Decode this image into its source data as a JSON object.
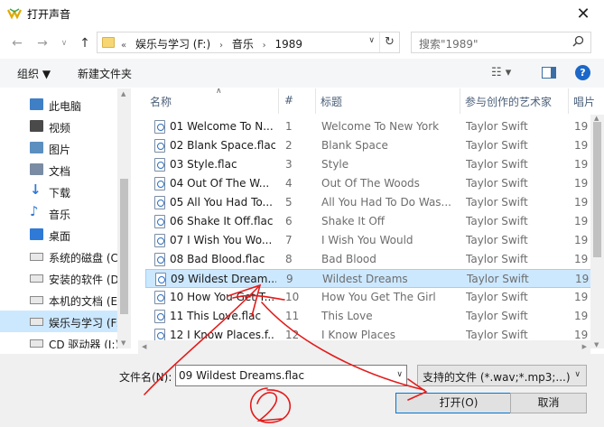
{
  "window": {
    "title": "打开声音",
    "close_glyph": "✕"
  },
  "address": {
    "prefix": "«",
    "crumbs": [
      "娱乐与学习 (F:)",
      "音乐",
      "1989"
    ],
    "separator": "›",
    "search_placeholder": "搜索\"1989\""
  },
  "toolbar": {
    "organize": "组织 ▼",
    "new_folder": "新建文件夹",
    "view_glyph": "☷ ▾",
    "help": "?"
  },
  "sidebar": {
    "items": [
      {
        "label": "此电脑",
        "icon": "computer-icon"
      },
      {
        "label": "视频",
        "icon": "video-icon"
      },
      {
        "label": "图片",
        "icon": "picture-icon"
      },
      {
        "label": "文档",
        "icon": "document-icon"
      },
      {
        "label": "下载",
        "icon": "download-icon"
      },
      {
        "label": "音乐",
        "icon": "music-icon"
      },
      {
        "label": "桌面",
        "icon": "desktop-icon"
      },
      {
        "label": "系统的磁盘 (C:)",
        "icon": "drive-icon"
      },
      {
        "label": "安装的软件 (D:)",
        "icon": "drive-icon"
      },
      {
        "label": "本机的文档 (E:)",
        "icon": "drive-icon"
      },
      {
        "label": "娱乐与学习 (F:)",
        "icon": "drive-icon"
      },
      {
        "label": "CD 驱动器 (I:)",
        "icon": "cd-drive-icon"
      }
    ],
    "selected_index": 10
  },
  "columns": {
    "name": "名称",
    "num": "#",
    "title": "标题",
    "artist": "参与创作的艺术家",
    "more": "唱片"
  },
  "files": [
    {
      "name": "01 Welcome To N...",
      "num": "1",
      "title": "Welcome To New York",
      "artist": "Taylor Swift",
      "more": "19"
    },
    {
      "name": "02 Blank Space.flac",
      "num": "2",
      "title": "Blank Space",
      "artist": "Taylor Swift",
      "more": "19"
    },
    {
      "name": "03 Style.flac",
      "num": "3",
      "title": "Style",
      "artist": "Taylor Swift",
      "more": "19"
    },
    {
      "name": "04 Out Of The W...",
      "num": "4",
      "title": "Out Of The Woods",
      "artist": "Taylor Swift",
      "more": "19"
    },
    {
      "name": "05 All You Had To...",
      "num": "5",
      "title": "All You Had To Do Was...",
      "artist": "Taylor Swift",
      "more": "19"
    },
    {
      "name": "06 Shake It Off.flac",
      "num": "6",
      "title": "Shake It Off",
      "artist": "Taylor Swift",
      "more": "19"
    },
    {
      "name": "07 I Wish You Wo...",
      "num": "7",
      "title": "I Wish You Would",
      "artist": "Taylor Swift",
      "more": "19"
    },
    {
      "name": "08 Bad Blood.flac",
      "num": "8",
      "title": "Bad Blood",
      "artist": "Taylor Swift",
      "more": "19"
    },
    {
      "name": "09 Wildest Dream...",
      "num": "9",
      "title": "Wildest Dreams",
      "artist": "Taylor Swift",
      "more": "19"
    },
    {
      "name": "10 How You Get T...",
      "num": "10",
      "title": "How You Get The Girl",
      "artist": "Taylor Swift",
      "more": "19"
    },
    {
      "name": "11 This Love.flac",
      "num": "11",
      "title": "This Love",
      "artist": "Taylor Swift",
      "more": "19"
    },
    {
      "name": "12 I Know Places.f...",
      "num": "12",
      "title": "I Know Places",
      "artist": "Taylor Swift",
      "more": "19"
    }
  ],
  "selected_file_index": 8,
  "footer": {
    "filename_label": "文件名(N):",
    "filename_value": "09 Wildest Dreams.flac",
    "filter_value": "支持的文件 (*.wav;*.mp3;...)",
    "open_button": "打开(O)",
    "cancel_button": "取消"
  },
  "annotation": {
    "color": "#e31b1b",
    "mark": "2"
  }
}
